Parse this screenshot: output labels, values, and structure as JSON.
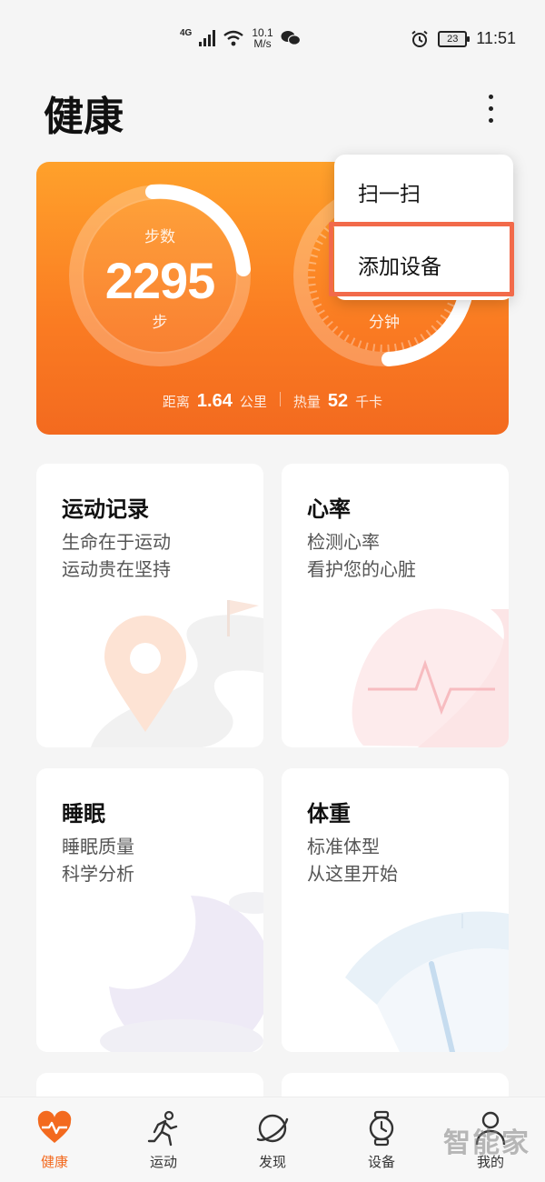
{
  "status_bar": {
    "network": "4G",
    "speed_value": "10.1",
    "speed_unit": "M/s",
    "battery": "23",
    "time": "11:51"
  },
  "header": {
    "title": "健康"
  },
  "summary": {
    "steps_label": "步数",
    "steps_value": "2295",
    "steps_unit": "步",
    "minutes_unit": "分钟",
    "distance_label": "距离",
    "distance_value": "1.64",
    "distance_unit": "公里",
    "calories_label": "热量",
    "calories_value": "52",
    "calories_unit": "千卡"
  },
  "menu": {
    "items": [
      {
        "label": "扫一扫"
      },
      {
        "label": "添加设备"
      }
    ]
  },
  "cards": [
    {
      "title": "运动记录",
      "line1": "生命在于运动",
      "line2": "运动贵在坚持",
      "icon": "location-pin-icon"
    },
    {
      "title": "心率",
      "line1": "检测心率",
      "line2": "看护您的心脏",
      "icon": "heart-icon"
    },
    {
      "title": "睡眠",
      "line1": "睡眠质量",
      "line2": "科学分析",
      "icon": "moon-icon"
    },
    {
      "title": "体重",
      "line1": "标准体型",
      "line2": "从这里开始",
      "icon": "scale-gauge-icon"
    }
  ],
  "nav": {
    "items": [
      {
        "label": "健康",
        "icon": "heart-pulse-icon",
        "active": true
      },
      {
        "label": "运动",
        "icon": "running-icon"
      },
      {
        "label": "发现",
        "icon": "planet-icon"
      },
      {
        "label": "设备",
        "icon": "watch-icon"
      },
      {
        "label": "我的",
        "icon": "person-icon"
      }
    ]
  },
  "watermark": "智能家",
  "colors": {
    "accent": "#f36a1f",
    "highlight": "#f26a4a"
  }
}
